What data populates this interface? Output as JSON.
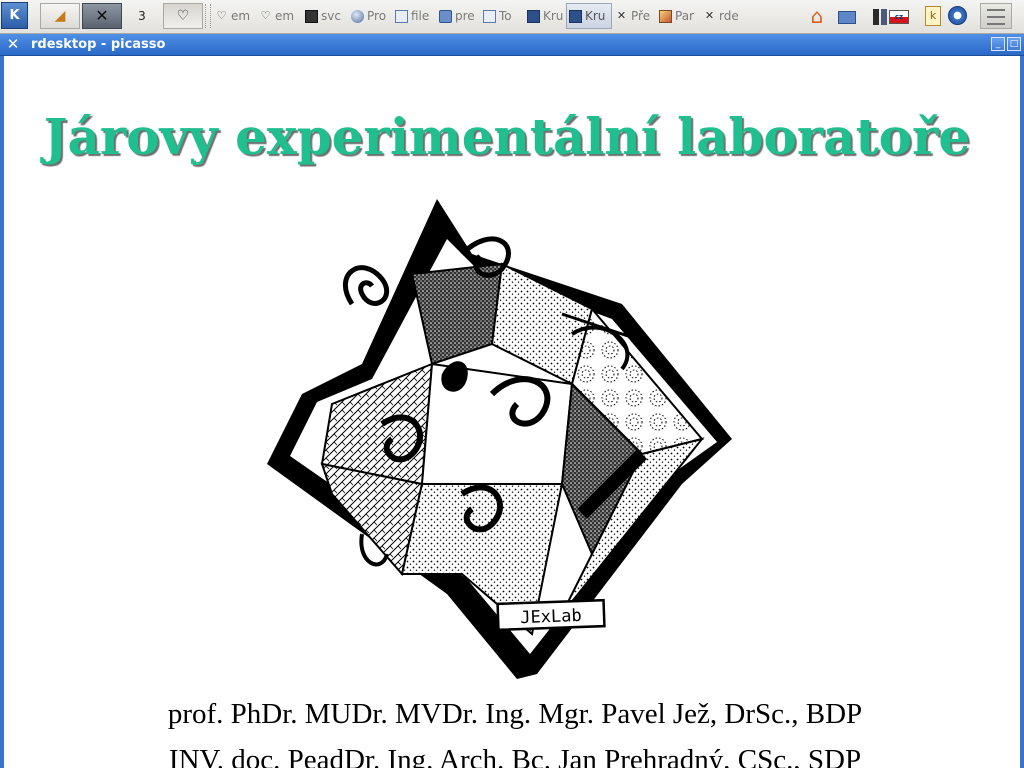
{
  "panel": {
    "kmenu_label": "K",
    "pager_label": "3",
    "tasks": [
      {
        "icon": "heart-icon",
        "label": "em"
      },
      {
        "icon": "heart-icon",
        "label": "em"
      },
      {
        "icon": "terminal-icon",
        "label": "svc"
      },
      {
        "icon": "globe-icon",
        "label": "Pro"
      },
      {
        "icon": "image-icon",
        "label": "file"
      },
      {
        "icon": "folder-icon",
        "label": "pre"
      },
      {
        "icon": "image-icon",
        "label": "To"
      },
      {
        "icon": "book-icon",
        "label": "Kru"
      },
      {
        "icon": "book-icon",
        "label": "Kru"
      },
      {
        "icon": "x-icon",
        "label": "Pře"
      },
      {
        "icon": "paint-icon",
        "label": "Par"
      },
      {
        "icon": "x-icon",
        "label": "rde"
      }
    ],
    "tray": {
      "keyboard_layout": "cz",
      "klipper_label": "k"
    }
  },
  "window": {
    "title": "rdesktop - picasso",
    "minimize_label": "_",
    "maximize_label": "□"
  },
  "page": {
    "heading": "Járovy experimentální laboratoře",
    "logo_label": "JExLab",
    "names": [
      "prof. PhDr. MUDr. MVDr. Ing. Mgr. Pavel Jež, DrSc., BDP",
      "INV. doc. PeadDr. Ing. Arch. Bc. Jan Prehradný, CSc., SDP"
    ]
  }
}
